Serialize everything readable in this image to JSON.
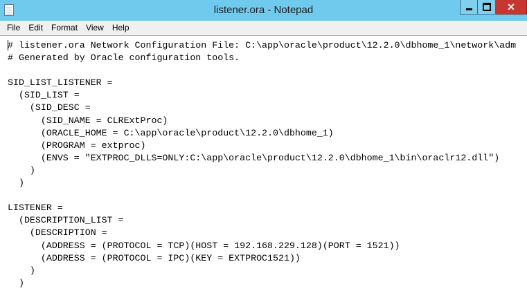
{
  "window": {
    "title": "listener.ora - Notepad",
    "close_symbol": "✕"
  },
  "menu": {
    "items": [
      "File",
      "Edit",
      "Format",
      "View",
      "Help"
    ]
  },
  "editor": {
    "content": "# listener.ora Network Configuration File: C:\\app\\oracle\\product\\12.2.0\\dbhome_1\\network\\adm\n# Generated by Oracle configuration tools.\n\nSID_LIST_LISTENER =\n  (SID_LIST =\n    (SID_DESC =\n      (SID_NAME = CLRExtProc)\n      (ORACLE_HOME = C:\\app\\oracle\\product\\12.2.0\\dbhome_1)\n      (PROGRAM = extproc)\n      (ENVS = \"EXTPROC_DLLS=ONLY:C:\\app\\oracle\\product\\12.2.0\\dbhome_1\\bin\\oraclr12.dll\")\n    )\n  )\n\nLISTENER =\n  (DESCRIPTION_LIST =\n    (DESCRIPTION =\n      (ADDRESS = (PROTOCOL = TCP)(HOST = 192.168.229.128)(PORT = 1521))\n      (ADDRESS = (PROTOCOL = IPC)(KEY = EXTPROC1521))\n    )\n  )"
  }
}
